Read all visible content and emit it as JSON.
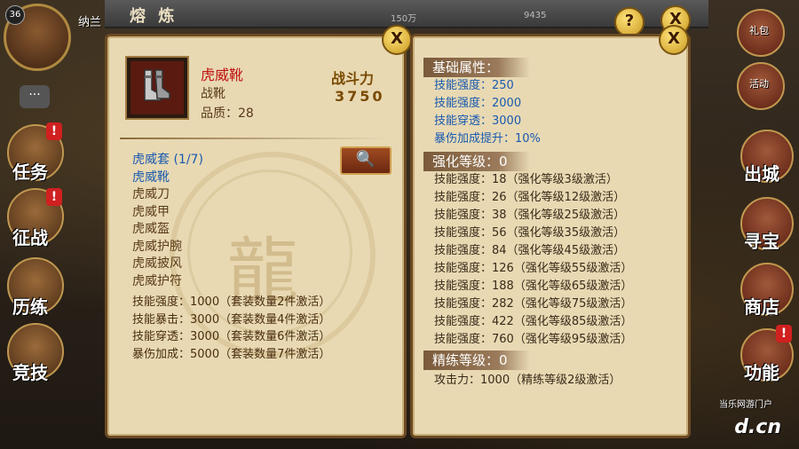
{
  "window": {
    "title": "熔 炼"
  },
  "hud_left": {
    "level": "36",
    "name_fragment": "纳兰",
    "buttons": [
      {
        "label": "任务",
        "badge": "!"
      },
      {
        "label": "征战",
        "badge": "!"
      },
      {
        "label": "历练"
      },
      {
        "label": "竞技"
      }
    ]
  },
  "hud_right": {
    "buttons": [
      {
        "label": "出城"
      },
      {
        "label": "寻宝"
      },
      {
        "label": "商店"
      },
      {
        "label": "功能",
        "badge": "!"
      }
    ],
    "small": [
      "礼包",
      "活动"
    ]
  },
  "top_stats": [
    "150万",
    "9435"
  ],
  "item": {
    "name": "虎威靴",
    "type": "战靴",
    "quality": "品质：28",
    "power_label": "战斗力",
    "power_value": "3750"
  },
  "set": {
    "title": "虎威套 (1/7)",
    "pieces": [
      "虎威靴",
      "虎威刀",
      "虎威甲",
      "虎威盔",
      "虎威护腕",
      "虎威披风",
      "虎威护符"
    ],
    "bonuses": [
      "技能强度：1000（套装数量2件激活）",
      "技能暴击：3000（套装数量4件激活）",
      "技能穿透：3000（套装数量6件激活）",
      "暴伤加成：5000（套装数量7件激活）"
    ]
  },
  "base": {
    "header": "基础属性：",
    "stats": [
      "技能强度：250",
      "技能强度：2000",
      "技能穿透：3000",
      "暴伤加成提升：10%"
    ]
  },
  "enhance": {
    "header": "强化等级：0",
    "stats": [
      "技能强度：18（强化等级3级激活）",
      "技能强度：26（强化等级12级激活）",
      "技能强度：38（强化等级25级激活）",
      "技能强度：56（强化等级35级激活）",
      "技能强度：84（强化等级45级激活）",
      "技能强度：126（强化等级55级激活）",
      "技能强度：188（强化等级65级激活）",
      "技能强度：282（强化等级75级激活）",
      "技能强度：422（强化等级85级激活）",
      "技能强度：760（强化等级95级激活）"
    ]
  },
  "refine": {
    "header": "精练等级：0",
    "stats": [
      "攻击力：1000（精练等级2级激活）"
    ]
  },
  "buttons": {
    "close": "X",
    "help": "?",
    "search": "🔍"
  },
  "watermark": {
    "top": "当乐网游门户",
    "main": "d.cn"
  }
}
